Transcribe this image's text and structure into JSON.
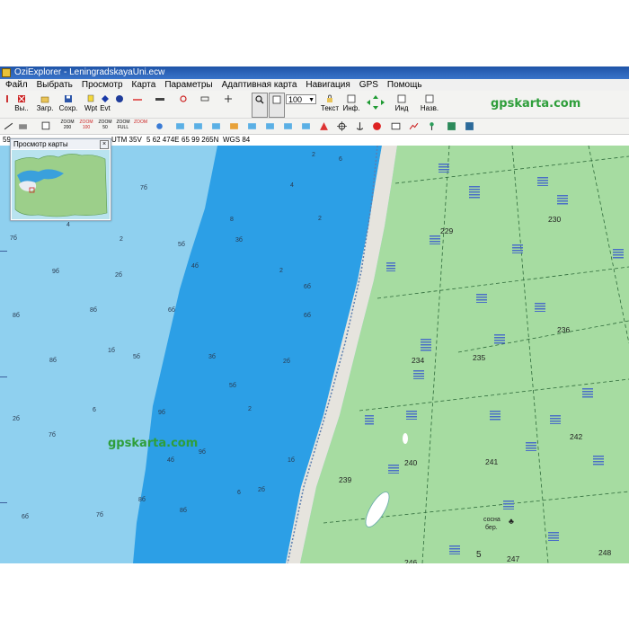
{
  "window": {
    "title": "OziExplorer - LeningradskayaUni.ecw"
  },
  "menu": [
    "Файл",
    "Выбрать",
    "Просмотр",
    "Карта",
    "Параметры",
    "Адаптивная карта",
    "Навигация",
    "GPS",
    "Помощь"
  ],
  "toolbar": {
    "exit_label": "Вы..",
    "load_label": "Загр.",
    "save_label": "Сохр.",
    "wpt_label": "Wpt",
    "evt_label": "Evt",
    "zoom_value": "100",
    "text_label": "Текст",
    "info_label": "Инф.",
    "ind_label": "Инд",
    "back_label": "Назв.",
    "zoom_buttons": [
      "ZOOM 200",
      "ZOOM 100",
      "ZOOM 50",
      "ZOOM FULL",
      "ZOOM"
    ]
  },
  "brand": {
    "site": "gpskarta.com",
    "color": "#2e9e3a"
  },
  "status": {
    "left": "59",
    "utm": "UTM 35V",
    "easting": "5 62 474E",
    "northing": "65 99 265N",
    "datum": "WGS 84"
  },
  "preview": {
    "title": "Просмотр карты"
  },
  "map": {
    "watermark": "gpskarta.com",
    "quarters": [
      "229",
      "230",
      "236",
      "234",
      "235",
      "242",
      "240",
      "241",
      "239",
      "246",
      "247",
      "248",
      "5"
    ],
    "place_label": "сосна",
    "place_label2": "бер.",
    "depths": [
      "2",
      "6",
      "7б",
      "8",
      "5б",
      "2",
      "4",
      "3б",
      "4б",
      "2",
      "6б",
      "6б",
      "7б",
      "2",
      "4",
      "9б",
      "2б",
      "8б",
      "8б",
      "6б",
      "1б",
      "5б",
      "3б",
      "2б",
      "8б",
      "5б",
      "2",
      "6",
      "9б",
      "2б",
      "7б",
      "9б",
      "4б",
      "1б",
      "2б",
      "6",
      "8б",
      "8б",
      "6б",
      "7б"
    ]
  },
  "colors": {
    "sea_light": "#8fd0ef",
    "sea_deep": "#2c9fe6",
    "land": "#a6dca1",
    "beach": "#e6e4de",
    "titlebar": "#2a62b8"
  }
}
